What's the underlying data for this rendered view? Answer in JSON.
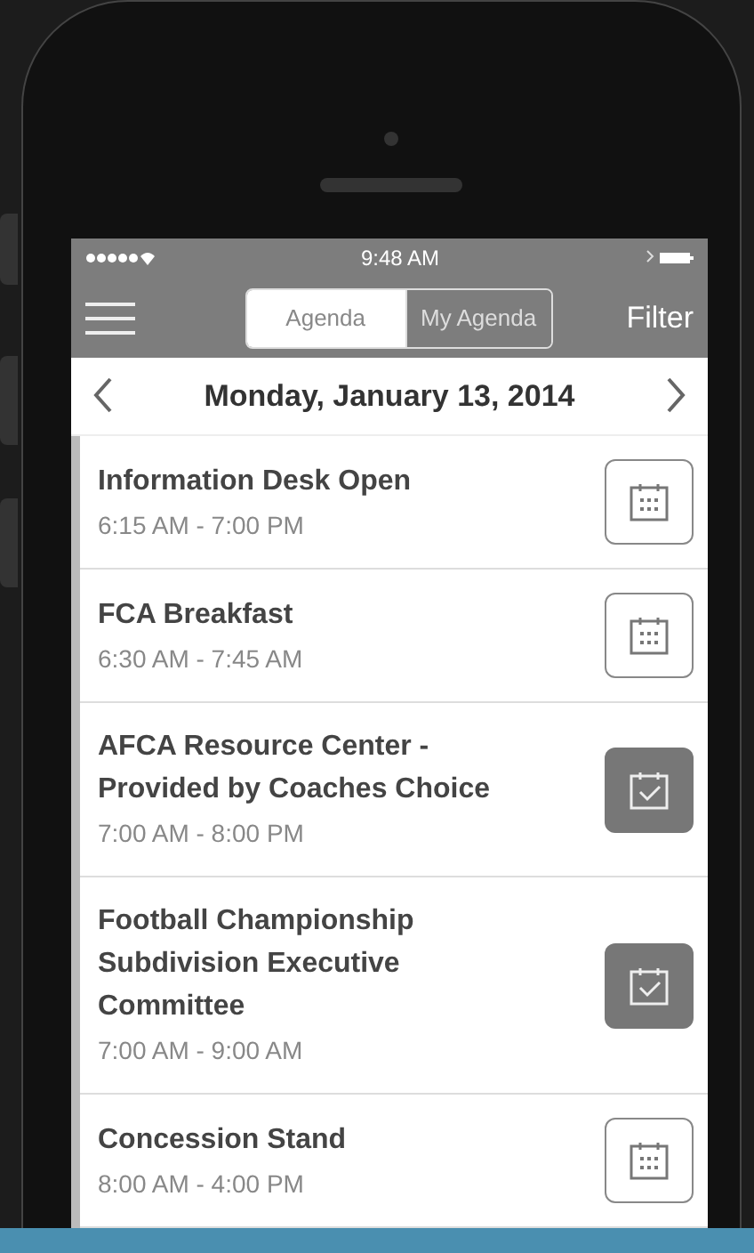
{
  "status_bar": {
    "time": "9:48 AM"
  },
  "nav": {
    "segments": [
      {
        "label": "Agenda",
        "selected": true
      },
      {
        "label": "My Agenda",
        "selected": false
      }
    ],
    "filter": "Filter"
  },
  "date_bar": {
    "date": "Monday, January 13, 2014"
  },
  "events": [
    {
      "title": "Information Desk Open",
      "time": "6:15 AM - 7:00 PM",
      "added": false
    },
    {
      "title": "FCA Breakfast",
      "time": "6:30 AM - 7:45 AM",
      "added": false
    },
    {
      "title": "AFCA Resource Center - Provided by Coaches Choice",
      "time": "7:00 AM - 8:00 PM",
      "added": true
    },
    {
      "title": "Football Championship Subdivision Executive Committee",
      "time": "7:00 AM - 9:00 AM",
      "added": true
    },
    {
      "title": "Concession Stand",
      "time": "8:00 AM - 4:00 PM",
      "added": false
    }
  ]
}
